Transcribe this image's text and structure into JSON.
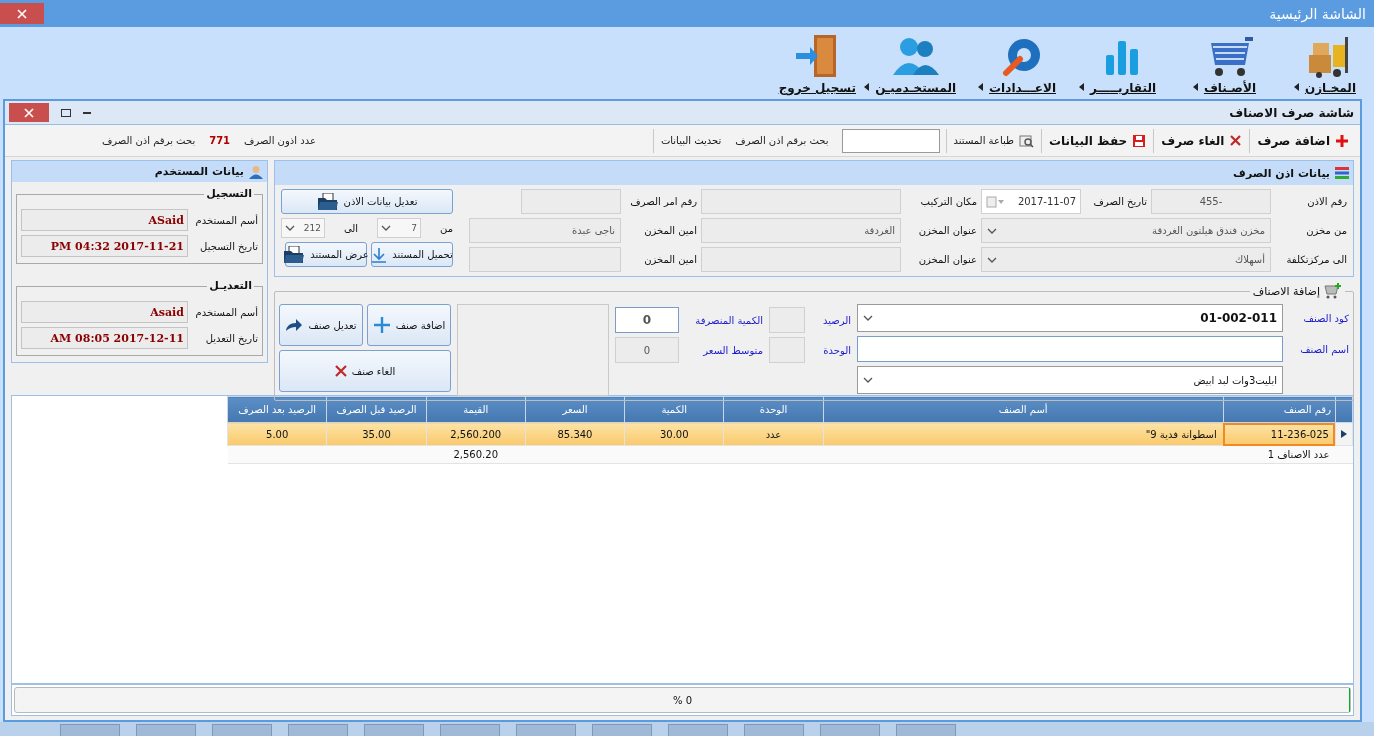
{
  "window": {
    "title": "الشاشة الرئيسية"
  },
  "ribbon": [
    {
      "label": "المخـازن",
      "menu": true
    },
    {
      "label": "الأصـناف",
      "menu": true
    },
    {
      "label": "التقاريـــــر",
      "menu": true
    },
    {
      "label": "الاعـــدادات",
      "menu": true
    },
    {
      "label": "المستخـدميـن",
      "menu": true
    },
    {
      "label": "تسجيل خروج",
      "menu": false
    }
  ],
  "form": {
    "title": "شاشة صرف الاصناف"
  },
  "toolbar": {
    "actions": [
      {
        "kind": "button",
        "label": "اضافة صرف"
      },
      {
        "kind": "button",
        "label": "الغاء صرف"
      },
      {
        "kind": "button",
        "label": "حفظ البيانات"
      },
      {
        "kind": "button",
        "label": "طباعة المستند"
      },
      {
        "kind": "field"
      },
      {
        "kind": "label",
        "text": "بحث برقم اذن الصرف"
      },
      {
        "kind": "button",
        "label": "تحديث البيانات"
      }
    ],
    "stats": [
      {
        "kind": "label",
        "text": "عدد اذون الصرف"
      },
      {
        "kind": "count",
        "text": "771"
      },
      {
        "kind": "label",
        "text": "بحث برقم اذن الصرف"
      }
    ]
  },
  "voucher": {
    "title": "بيانات اذن الصرف",
    "fields": [
      {
        "label": "رقم الاذن",
        "kind": "field",
        "value": "455-"
      },
      {
        "label": "تاريخ الصرف",
        "kind": "date",
        "value": "2017-11-07"
      },
      {
        "label": "مكان التركيب",
        "kind": "field"
      },
      {
        "label": "رقم امر الصرف",
        "kind": "field"
      },
      {
        "label": "من مخزن",
        "kind": "combo",
        "value": "مخزن فندق هيلتون الغردقة"
      },
      {
        "label": "عنوان المخزن",
        "kind": "field",
        "value": "الغردقة"
      },
      {
        "label": "امين المخزن",
        "kind": "field",
        "value": "ناجي عبدة"
      },
      {
        "label": "الى مركزتكلفة",
        "kind": "combo",
        "value": "أسهلاك"
      },
      {
        "label": "عنوان المخزن",
        "kind": "field"
      },
      {
        "label": "امين المخزن",
        "kind": "field"
      }
    ],
    "edit_button": "تعديل بيانات الاذن",
    "range": [
      {
        "label": "من",
        "value": "7"
      },
      {
        "label": "الى",
        "value": "212"
      }
    ],
    "doc_buttons": [
      "تحميل المستند",
      "عرض المستند"
    ]
  },
  "items": {
    "title": "إضافة الاصناف",
    "code": {
      "label": "كود الصنف",
      "value": "01-002-011"
    },
    "name": {
      "label": "اسم الصنف"
    },
    "description": {
      "value": "ابليت3وات لبد ابيض"
    },
    "stats": [
      {
        "label": "الرصيد"
      },
      {
        "label": "الوحدة"
      }
    ],
    "amounts": [
      {
        "label": "الكمية المنصرفة",
        "value": "0",
        "editable": true
      },
      {
        "label": "متوسط السعر",
        "value": "0",
        "editable": false
      }
    ],
    "buttons": [
      "اضافة صنف",
      "تعديل صنف",
      "الغاء صنف"
    ]
  },
  "user": {
    "title": "بيانات المستخدم",
    "groups": [
      {
        "title": "التسجيل",
        "fields": [
          {
            "label": "أسم المستخدم",
            "value": "ASaid"
          },
          {
            "label": "تاريخ التسجيل",
            "value": "PM 04:32 2017-11-21"
          }
        ]
      },
      {
        "title": "التعديـل",
        "fields": [
          {
            "label": "أسم المستخدم",
            "value": "Asaid"
          },
          {
            "label": "تاريخ التعديل",
            "value": "AM 08:05 2017-12-11"
          }
        ]
      }
    ]
  },
  "table": {
    "columns": [
      "رقم الصنف",
      "أسم الصنف",
      "الوحدة",
      "الكمية",
      "السعر",
      "القيمة",
      "الرصيد قبل الصرف",
      "الرصيد بعد الصرف"
    ],
    "rows": [
      {
        "selected": true,
        "cells": [
          "11-236-025",
          "اسطوانة فدية 9\"",
          "عدد",
          "30.00",
          "85.340",
          "2,560.200",
          "35.00",
          "5.00"
        ]
      }
    ],
    "footer": {
      "count": "عدد الاصناف 1",
      "total": "2,560.20"
    }
  },
  "progress": {
    "level": 0,
    "reading": "% 0"
  }
}
